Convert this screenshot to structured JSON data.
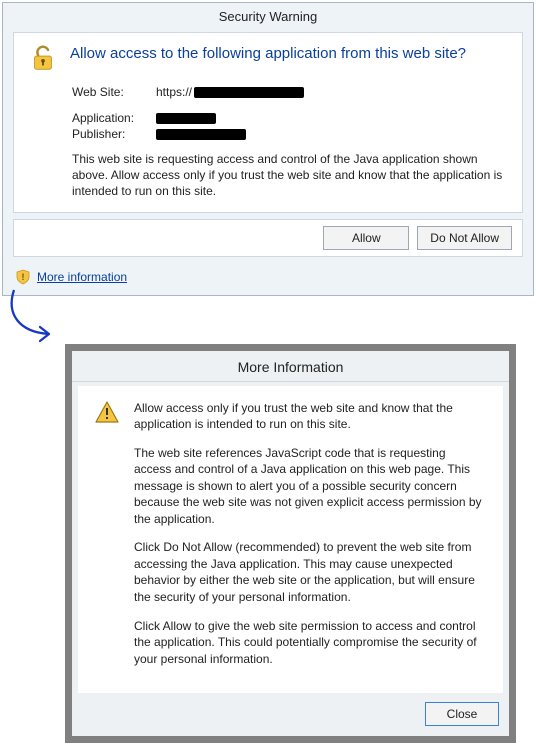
{
  "dialog1": {
    "title": "Security Warning",
    "question": "Allow access to the following application from this web site?",
    "fields": {
      "website_label": "Web Site:",
      "website_value_prefix": "https://",
      "application_label": "Application:",
      "publisher_label": "Publisher:"
    },
    "body": "This web site is requesting access and control of the Java application shown above. Allow access only if you trust the web site and know that the application is intended to run on this site.",
    "allow_btn": "Allow",
    "deny_btn": "Do Not Allow",
    "more_link": "More information"
  },
  "dialog2": {
    "title": "More Information",
    "p1": "Allow access only if you trust the web site and know that the application is intended to run on this site.",
    "p2": "The web site references JavaScript code that is requesting access and control of a Java application on this web page. This message is shown to alert you of a possible security concern because the web site was not given explicit access permission by the application.",
    "p3": "Click Do Not Allow (recommended) to prevent the web site from accessing the Java application. This may cause unexpected behavior by either the web site or the application, but will ensure the security of your personal information.",
    "p4": "Click Allow to give the web site permission to access and control the application. This could potentially compromise the security of your personal information.",
    "close_btn": "Close"
  }
}
